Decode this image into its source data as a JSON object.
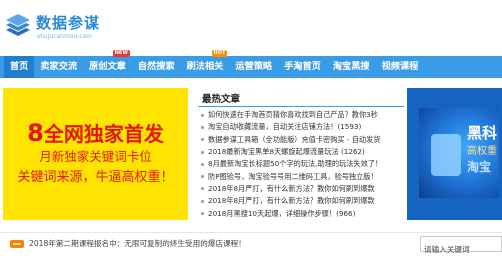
{
  "header": {
    "site_name": "数据参谋",
    "site_url": "shujucanmou.com"
  },
  "nav": {
    "items": [
      {
        "label": "首页",
        "active": true
      },
      {
        "label": "卖家交流",
        "badge": null
      },
      {
        "label": "原创文章",
        "badge": "NEW"
      },
      {
        "label": "自然搜索"
      },
      {
        "label": "刷法相关",
        "badge": "HOT"
      },
      {
        "label": "运营策略"
      },
      {
        "label": "手淘首页"
      },
      {
        "label": "淘宝黑搜"
      },
      {
        "label": "视频课程"
      }
    ]
  },
  "left_ad": {
    "line1_num": "8",
    "line1_text": "全网独家首发",
    "line2": "月新独家关键词卡位",
    "line3": "关键词来源，牛逼高权重！"
  },
  "hot_articles": {
    "title": "最热文章",
    "items": [
      "如何快速在手淘首页猜你喜欢找到自己产品？教你3秒",
      "淘宝自动收藏流量，自动关注店铺方法！(1593)",
      "数据参谋工具箱（全功能版）充值卡密购买 - 自动发货",
      "2018最新淘宝黑单8天螺旋起爆流量玩法 (1262)",
      "8月最新淘宝长标题50个字的玩法,助理的玩法失效了！",
      "防P图验号，淘宝验号号用二维码工具，验号独立版！",
      "2018年8月严打，有什么新方法？教你如何刷到爆款",
      "2018年8月严打，有什么新方法？教你如何刷到爆款",
      "2018月黑搜10天起爆，详细操作步骤！(966)"
    ]
  },
  "right_ad": {
    "text1": "黑科",
    "text2": "高权重",
    "text3": "淘宝"
  },
  "notice": {
    "text": "2018年第二期课程报名中：无限可复制的终生受用的爆店课程！"
  },
  "search": {
    "placeholder": "请输入关键词"
  },
  "colors": {
    "brand_blue": "#3a9be6",
    "ad_yellow": "#ffe401",
    "ad_red": "#e3170a"
  }
}
